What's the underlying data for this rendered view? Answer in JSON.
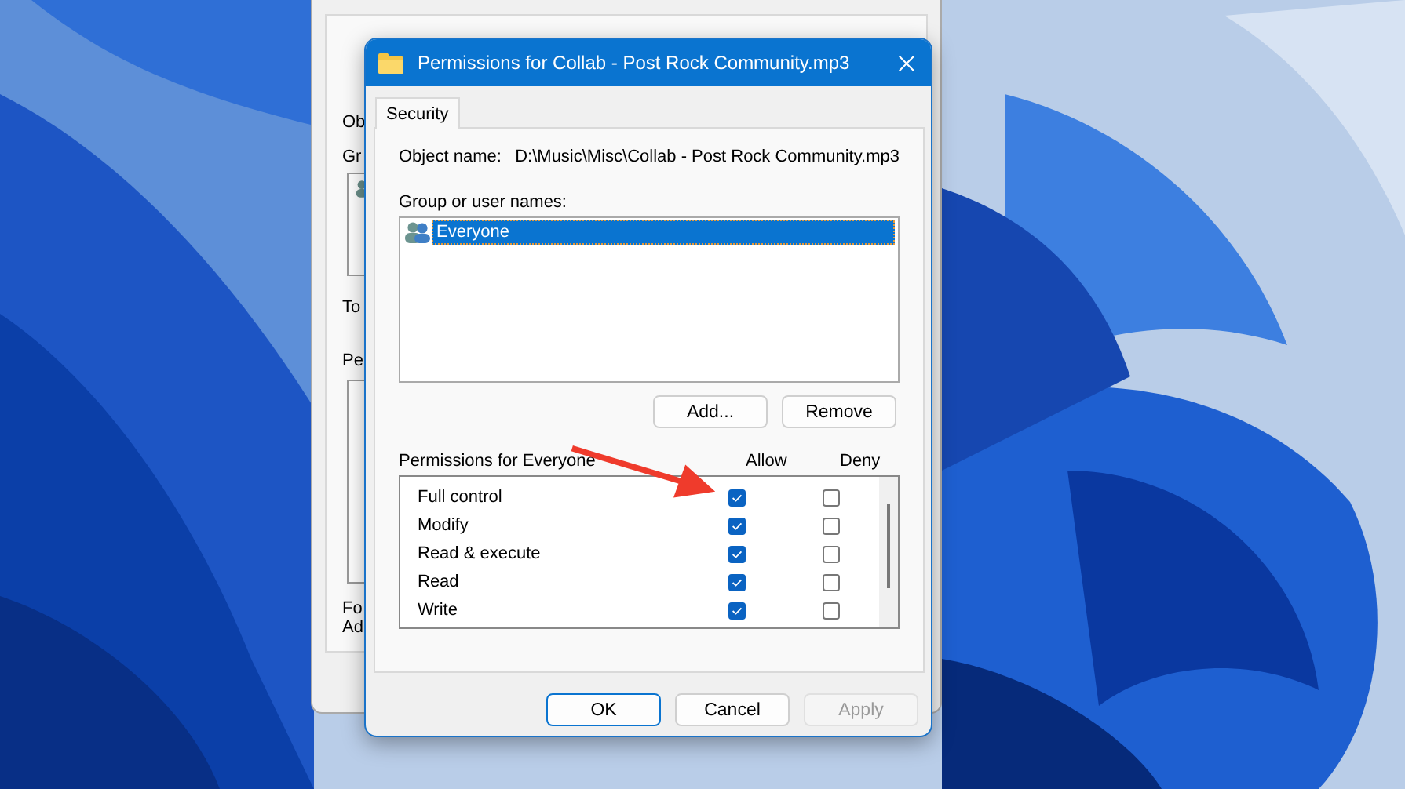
{
  "back_dialog": {
    "labels": [
      "Ob",
      "Gr",
      "To",
      "Pe",
      "Fo",
      "Ad"
    ]
  },
  "dialog": {
    "title": "Permissions for Collab - Post Rock Community.mp3",
    "tabs": [
      {
        "label": "Security",
        "selected": true
      }
    ],
    "object_name_label": "Object name:",
    "object_name_value": "D:\\Music\\Misc\\Collab - Post Rock Community.mp3",
    "group_label": "Group or user names:",
    "users": [
      {
        "name": "Everyone",
        "selected": true
      }
    ],
    "user_buttons": [
      {
        "label": "Add..."
      },
      {
        "label": "Remove"
      }
    ],
    "permissions_label": "Permissions for Everyone",
    "allow_header": "Allow",
    "deny_header": "Deny",
    "permissions": [
      {
        "name": "Full control",
        "allow": true,
        "deny": false
      },
      {
        "name": "Modify",
        "allow": true,
        "deny": false
      },
      {
        "name": "Read & execute",
        "allow": true,
        "deny": false
      },
      {
        "name": "Read",
        "allow": true,
        "deny": false
      },
      {
        "name": "Write",
        "allow": true,
        "deny": false
      }
    ],
    "buttons": [
      {
        "label": "OK",
        "default": true,
        "disabled": false
      },
      {
        "label": "Cancel",
        "default": false,
        "disabled": false
      },
      {
        "label": "Apply",
        "default": false,
        "disabled": true
      }
    ]
  }
}
